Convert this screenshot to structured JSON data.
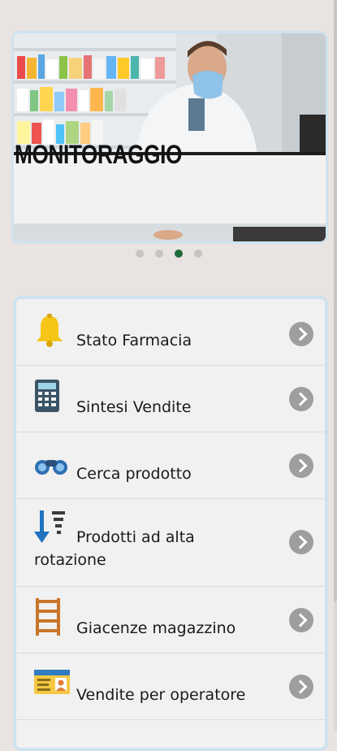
{
  "carousel": {
    "title": "MONITORAGGIO",
    "dots": [
      false,
      false,
      true,
      false
    ]
  },
  "menu": {
    "items": [
      {
        "label": "Stato Farmacia",
        "icon": "bell-icon"
      },
      {
        "label": "Sintesi Vendite",
        "icon": "calculator-icon"
      },
      {
        "label": "Cerca prodotto",
        "icon": "binoculars-icon"
      },
      {
        "label": "Prodotti ad alta",
        "label2": "rotazione",
        "icon": "sort-descending-icon"
      },
      {
        "label": "Giacenze magazzino",
        "icon": "shelves-icon"
      },
      {
        "label": "Vendite per operatore",
        "icon": "id-card-icon"
      }
    ]
  },
  "colors": {
    "background": "#e9e3e2",
    "card_border": "#cfe2ef",
    "active_dot": "#1e6b3a",
    "chevron": "#9e9e9e"
  }
}
